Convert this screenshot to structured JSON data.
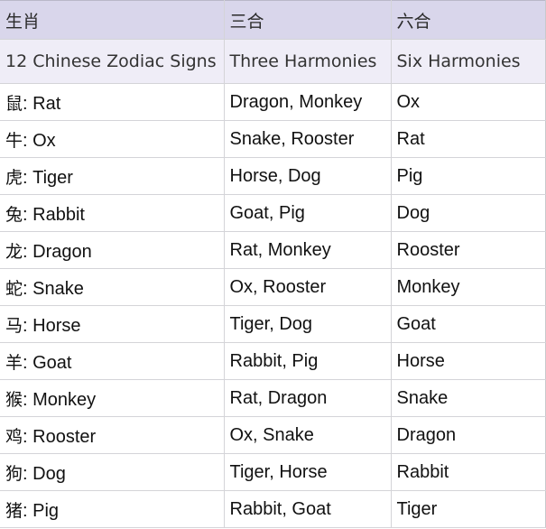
{
  "table": {
    "header_cn": [
      "生肖",
      "三合",
      "六合"
    ],
    "header_en": [
      "12 Chinese Zodiac Signs",
      "Three Harmonies",
      "Six Harmonies"
    ],
    "rows": [
      {
        "sign_cn": "鼠",
        "sign_en": ": Rat",
        "three_harmonies": "Dragon, Monkey",
        "six_harmonies": "Ox"
      },
      {
        "sign_cn": "牛",
        "sign_en": ": Ox",
        "three_harmonies": "Snake, Rooster",
        "six_harmonies": "Rat"
      },
      {
        "sign_cn": "虎",
        "sign_en": ": Tiger",
        "three_harmonies": "Horse,  Dog",
        "six_harmonies": "Pig"
      },
      {
        "sign_cn": "兔",
        "sign_en": ": Rabbit",
        "three_harmonies": "Goat, Pig",
        "six_harmonies": "Dog"
      },
      {
        "sign_cn": "龙",
        "sign_en": ": Dragon",
        "three_harmonies": "Rat, Monkey",
        "six_harmonies": "Rooster"
      },
      {
        "sign_cn": "蛇",
        "sign_en": ": Snake",
        "three_harmonies": "Ox, Rooster",
        "six_harmonies": "Monkey"
      },
      {
        "sign_cn": "马",
        "sign_en": ": Horse",
        "three_harmonies": "Tiger, Dog",
        "six_harmonies": "Goat"
      },
      {
        "sign_cn": "羊",
        "sign_en": ": Goat",
        "three_harmonies": "Rabbit, Pig",
        "six_harmonies": "Horse"
      },
      {
        "sign_cn": "猴",
        "sign_en": ": Monkey",
        "three_harmonies": "Rat, Dragon",
        "six_harmonies": "Snake"
      },
      {
        "sign_cn": "鸡",
        "sign_en": ": Rooster",
        "three_harmonies": "Ox, Snake",
        "six_harmonies": "Dragon"
      },
      {
        "sign_cn": "狗",
        "sign_en": ": Dog",
        "three_harmonies": "Tiger, Horse",
        "six_harmonies": "Rabbit"
      },
      {
        "sign_cn": "猪",
        "sign_en": ": Pig",
        "three_harmonies": "Rabbit, Goat",
        "six_harmonies": "Tiger"
      }
    ]
  },
  "colors": {
    "header_cn_bg": "#d9d6eb",
    "header_en_bg": "#efedf7",
    "grid": "#d4d4d8"
  }
}
